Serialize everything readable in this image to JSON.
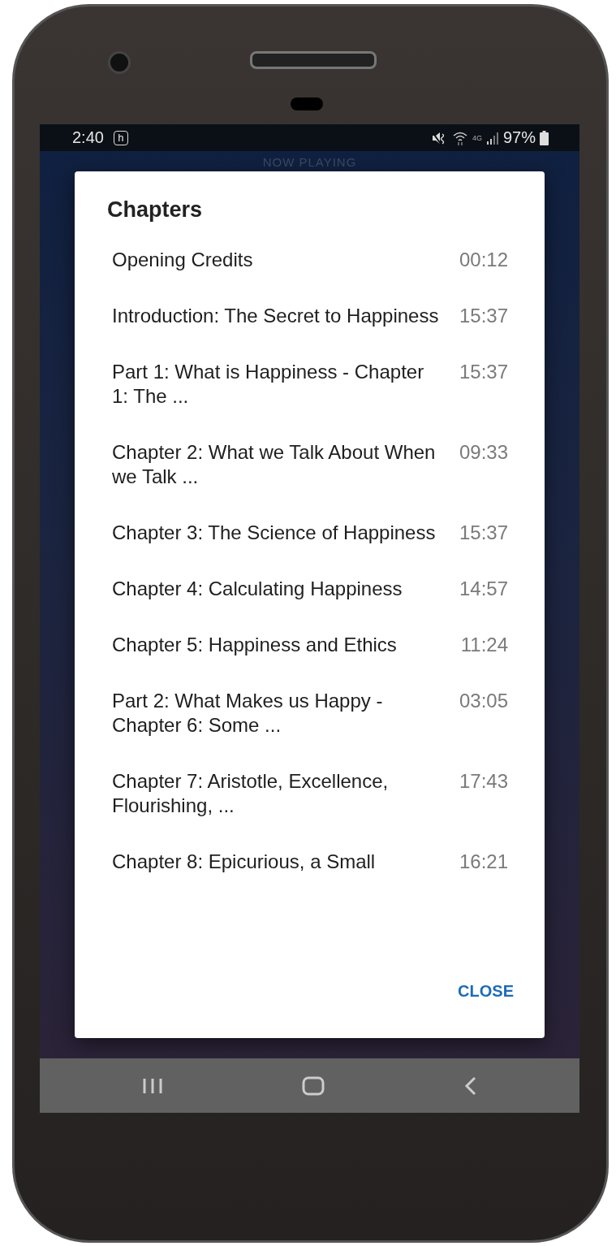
{
  "status_bar": {
    "time": "2:40",
    "notification_letter": "h",
    "network": "4G",
    "battery": "97%"
  },
  "app_header": {
    "title": "NOW PLAYING"
  },
  "dialog": {
    "title": "Chapters",
    "chapters": [
      {
        "title": "Opening Credits",
        "time": "00:12"
      },
      {
        "title": "Introduction: The Secret to Happiness",
        "time": "15:37"
      },
      {
        "title": "Part 1: What is Happiness - Chapter 1: The ...",
        "time": "15:37"
      },
      {
        "title": "Chapter 2: What we Talk About When we Talk ...",
        "time": "09:33"
      },
      {
        "title": "Chapter 3: The Science of Happiness",
        "time": "15:37"
      },
      {
        "title": "Chapter 4: Calculating Happiness",
        "time": "14:57"
      },
      {
        "title": "Chapter 5: Happiness and Ethics",
        "time": "11:24"
      },
      {
        "title": "Part 2: What Makes us Happy - Chapter 6: Some ...",
        "time": "03:05"
      },
      {
        "title": "Chapter 7: Aristotle, Excellence, Flourishing, ...",
        "time": "17:43"
      },
      {
        "title": "Chapter 8: Epicurious, a Small",
        "time": "16:21"
      }
    ],
    "close_button": "CLOSE"
  }
}
